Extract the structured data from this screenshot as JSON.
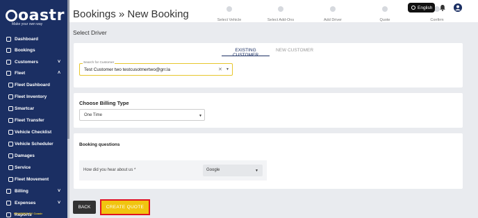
{
  "brand": {
    "name": "oastr",
    "tagline": "Make your own way",
    "powered": "POWERED BY Coastr"
  },
  "sidebar": {
    "items": [
      {
        "label": "Dashboard",
        "icon": "dashboard-icon",
        "chev": ""
      },
      {
        "label": "Bookings",
        "icon": "bookings-icon",
        "chev": ""
      },
      {
        "label": "Customers",
        "icon": "customers-icon",
        "chev": "˅"
      },
      {
        "label": "Fleet",
        "icon": "fleet-icon",
        "chev": "˄"
      },
      {
        "label": "Fleet Dashboard",
        "icon": "fleet-dashboard-icon",
        "chev": ""
      },
      {
        "label": "Fleet Inventory",
        "icon": "fleet-inventory-icon",
        "chev": ""
      },
      {
        "label": "Smartcar",
        "icon": "smartcar-icon",
        "chev": ""
      },
      {
        "label": "Fleet Transfer",
        "icon": "fleet-transfer-icon",
        "chev": ""
      },
      {
        "label": "Vehicle Checklist",
        "icon": "vehicle-checklist-icon",
        "chev": ""
      },
      {
        "label": "Vehicle Scheduler",
        "icon": "vehicle-scheduler-icon",
        "chev": ""
      },
      {
        "label": "Damages",
        "icon": "damages-icon",
        "chev": ""
      },
      {
        "label": "Service",
        "icon": "service-icon",
        "chev": ""
      },
      {
        "label": "Fleet Movement",
        "icon": "fleet-movement-icon",
        "chev": ""
      },
      {
        "label": "Billing",
        "icon": "billing-icon",
        "chev": "˅"
      },
      {
        "label": "Expenses",
        "icon": "expenses-icon",
        "chev": "˅"
      },
      {
        "label": "Reports",
        "icon": "reports-icon",
        "chev": ""
      }
    ]
  },
  "header": {
    "title": "Bookings » New  Booking",
    "language": "English"
  },
  "steps": [
    "Select Vehicle",
    "Select Add-Ons",
    "Add Driver",
    "Quote",
    "Confirm"
  ],
  "page": {
    "section_title": "Select Driver"
  },
  "tabs": {
    "existing": "EXISTING CUSTOMER",
    "new": "NEW CUSTOMER"
  },
  "search": {
    "label": "Search for Customer",
    "value": "Test Customer two testcusotmertwo@grr.la",
    "clear": "✕"
  },
  "billing": {
    "title": "Choose Billing Type",
    "value": "One Time"
  },
  "questions": {
    "title": "Booking questions",
    "q1": "How did you hear about us *",
    "q1_value": "Google"
  },
  "buttons": {
    "back": "BACK",
    "create_quote": "CREATE QUOTE"
  },
  "colors": {
    "sidebar": "#1b2f63",
    "accent": "#f1c40f",
    "highlight": "#e0131f"
  }
}
